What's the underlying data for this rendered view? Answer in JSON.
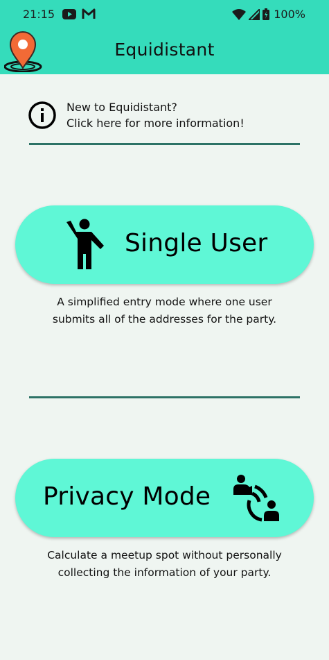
{
  "status_bar": {
    "time": "21:15",
    "battery": "100%"
  },
  "app_bar": {
    "title": "Equidistant",
    "logo_icon": "map-pin-logo-icon"
  },
  "info_banner": {
    "line1": "New to Equidistant?",
    "line2": "Click here for more information!",
    "icon": "info-icon"
  },
  "modes": [
    {
      "label": "Single User",
      "icon": "person-waving-icon",
      "description_line1": "A simplified entry mode where one user",
      "description_line2": "submits all of the addresses for the party."
    },
    {
      "label": "Privacy Mode",
      "icon": "users-signal-icon",
      "description_line1": "Calculate a meetup spot without personally",
      "description_line2": "collecting the information of your party."
    }
  ],
  "colors": {
    "accent": "#35dcbb",
    "button": "#5ff7d6",
    "background": "#eff5f1",
    "divider": "#2d7266",
    "logo_orange": "#f26a36"
  }
}
